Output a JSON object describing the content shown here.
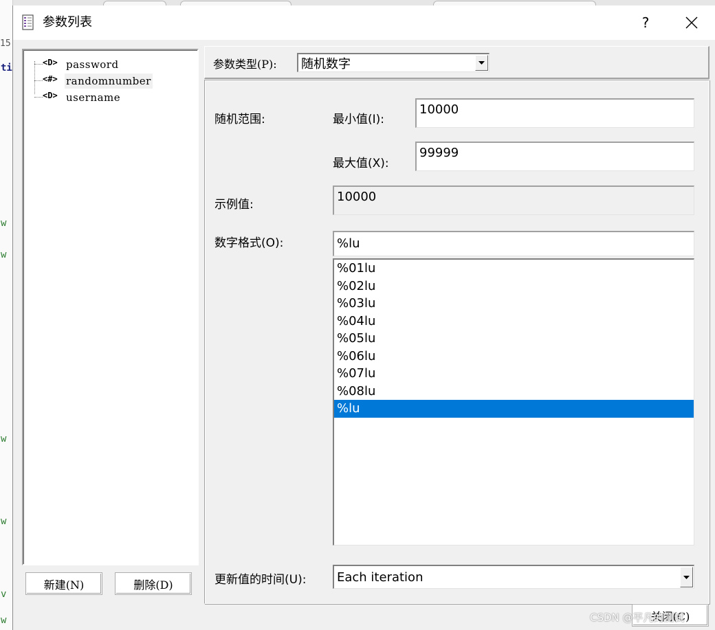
{
  "background_app": {
    "left_gutter_number": "15",
    "left_gutter_marks": [
      "ti",
      "w",
      "w",
      "w",
      "w",
      "v",
      "w"
    ]
  },
  "dialog": {
    "title": "参数列表",
    "help_label": "?",
    "close_icon": "close-x-icon"
  },
  "tree": {
    "items": [
      {
        "glyph": "<D>",
        "label": "password",
        "selected": false
      },
      {
        "glyph": "<#>",
        "label": "randomnumber",
        "selected": true
      },
      {
        "glyph": "<D>",
        "label": "username",
        "selected": false
      }
    ]
  },
  "buttons": {
    "new_label": "新建(N)",
    "delete_label": "删除(D)",
    "close_label": "关闭(C)"
  },
  "param_type": {
    "label": "参数类型(P):",
    "value": "随机数字"
  },
  "config": {
    "range_label": "随机范围:",
    "min_label": "最小值(I):",
    "min_value": "10000",
    "max_label": "最大值(X):",
    "max_value": "99999",
    "sample_label": "示例值:",
    "sample_value": "10000",
    "format_label": "数字格式(O):",
    "format_value": "%lu",
    "format_options": [
      "%01lu",
      "%02lu",
      "%03lu",
      "%04lu",
      "%05lu",
      "%06lu",
      "%07lu",
      "%08lu",
      "%lu"
    ],
    "format_selected": "%lu",
    "update_label": "更新值的时间(U):",
    "update_value": "Each iteration"
  },
  "watermark": "CSDN @平凡的测试",
  "colors": {
    "selection": "#0078d7",
    "dialog_bg": "#f0f0f0"
  }
}
